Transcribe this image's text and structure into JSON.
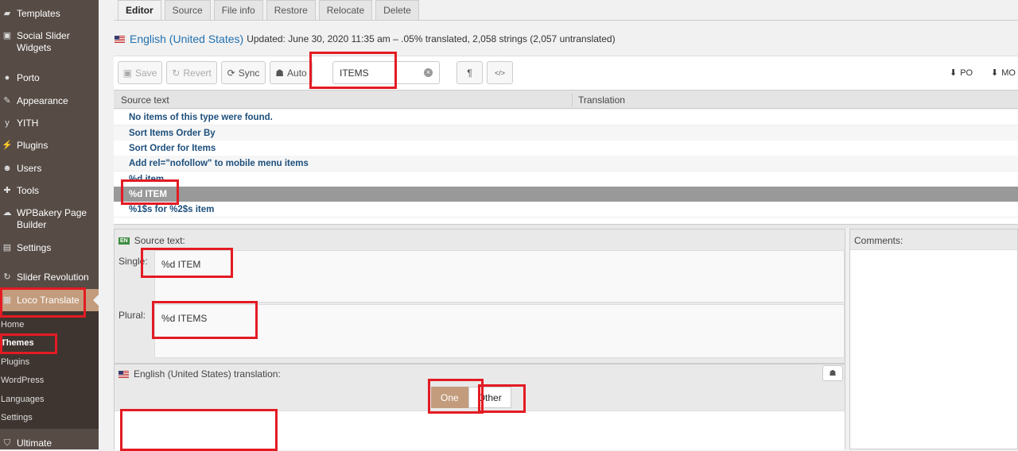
{
  "sidebar": {
    "items": [
      {
        "icon": "folder-icon",
        "label": "Templates"
      },
      {
        "icon": "slider-icon",
        "label": "Social Slider Widgets"
      },
      {
        "icon": "porto-icon",
        "label": "Porto"
      },
      {
        "icon": "brush-icon",
        "label": "Appearance"
      },
      {
        "icon": "yith-icon",
        "label": "YITH"
      },
      {
        "icon": "plug-icon",
        "label": "Plugins"
      },
      {
        "icon": "users-icon",
        "label": "Users"
      },
      {
        "icon": "wrench-icon",
        "label": "Tools"
      },
      {
        "icon": "wpbakery-icon",
        "label": "WPBakery Page Builder"
      },
      {
        "icon": "settings-icon",
        "label": "Settings"
      },
      {
        "icon": "refresh-icon",
        "label": "Slider Revolution"
      },
      {
        "icon": "translate-icon",
        "label": "Loco Translate"
      }
    ],
    "submenu": [
      "Home",
      "Themes",
      "Plugins",
      "WordPress",
      "Languages",
      "Settings"
    ],
    "bottom": {
      "icon": "shield-icon",
      "label": "Ultimate"
    }
  },
  "tabs": [
    "Editor",
    "Source",
    "File info",
    "Restore",
    "Relocate",
    "Delete"
  ],
  "header": {
    "language": "English (United States)",
    "meta": "Updated: June 30, 2020 11:35 am – .05% translated, 2,058 strings (2,057 untranslated)"
  },
  "toolbar": {
    "save": "Save",
    "revert": "Revert",
    "sync": "Sync",
    "auto": "Auto",
    "search_value": "ITEMS",
    "pilcrow": "¶",
    "code": "</>",
    "po": "PO",
    "mo": "MO"
  },
  "list": {
    "source_header": "Source text",
    "translation_header": "Translation",
    "rows": [
      "No items of this type were found.",
      "Sort Items Order By",
      "Sort Order for Items",
      "Add rel=\"nofollow\" to mobile menu items",
      "%d item",
      "%d ITEM",
      "%1$s for %2$s item"
    ]
  },
  "source_panel": {
    "badge": "EN",
    "title": "Source text:",
    "single_label": "Single:",
    "single_value": "%d ITEM",
    "plural_label": "Plural:",
    "plural_value": "%d ITEMS"
  },
  "comments": {
    "title": "Comments:"
  },
  "translation_panel": {
    "title": "English (United States) translation:",
    "forms": [
      "One",
      "Other"
    ],
    "value": ""
  },
  "colors": {
    "sidebar": "#564b45",
    "accent": "#c29c7d",
    "link": "#2271b1",
    "highlight": "#e31b23"
  }
}
